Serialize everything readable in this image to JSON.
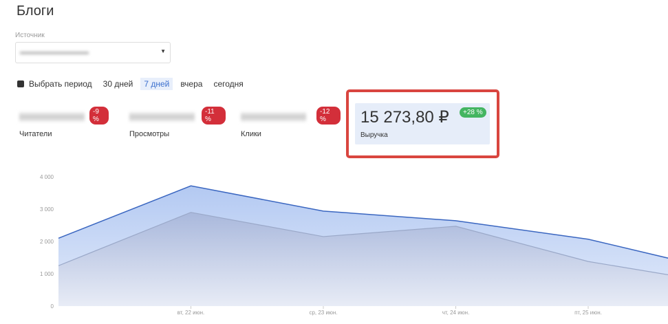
{
  "page_title": "Блоги",
  "source": {
    "label": "Источник"
  },
  "periods": {
    "choose": "Выбрать период",
    "items": [
      "30 дней",
      "7 дней",
      "вчера",
      "сегодня"
    ],
    "active": "7 дней"
  },
  "metrics": [
    {
      "label": "Читатели",
      "change": "-9 %"
    },
    {
      "label": "Просмотры",
      "change": "-11 %"
    },
    {
      "label": "Клики",
      "change": "-12 %"
    }
  ],
  "revenue": {
    "value": "15 273,80 ₽",
    "label": "Выручка",
    "change": "+28 %"
  },
  "colors": {
    "accent": "#3b6fce",
    "negative": "#d32f3a",
    "positive": "#44b561",
    "highlight": "#d9453f"
  },
  "chart_data": {
    "type": "area",
    "x": [
      "",
      "вт, 22 июн.",
      "ср, 23 июн.",
      "чт, 24 июн.",
      "пт, 25 июн.",
      ""
    ],
    "yticks": [
      "0",
      "1 000",
      "2 000",
      "3 000",
      "4 000"
    ],
    "ylim": [
      0,
      4000
    ],
    "series": [
      {
        "name": "upper",
        "values": [
          2100,
          3720,
          2940,
          2640,
          2070,
          1100
        ]
      },
      {
        "name": "lower",
        "values": [
          1250,
          2900,
          2150,
          2470,
          1380,
          700
        ]
      }
    ]
  }
}
